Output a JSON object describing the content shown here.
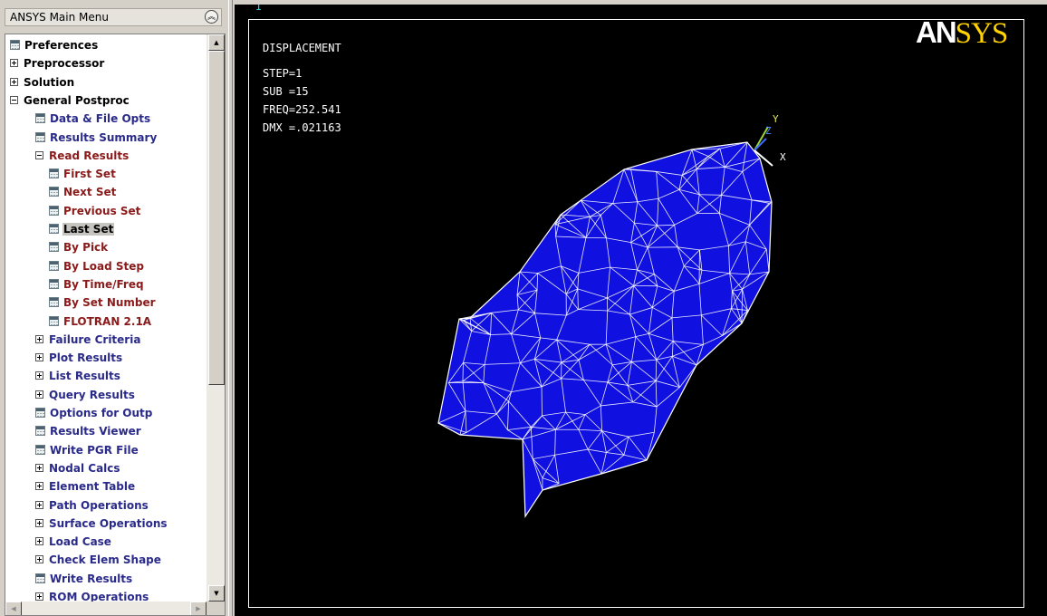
{
  "menu": {
    "title": "ANSYS Main Menu",
    "collapse_icon": "double-chevron-up-icon",
    "items": [
      {
        "label": "Preferences",
        "icon": "calc",
        "level": 0,
        "color": "#000000",
        "selected": false
      },
      {
        "label": "Preprocessor",
        "icon": "plus",
        "level": 0,
        "color": "#000000",
        "selected": false
      },
      {
        "label": "Solution",
        "icon": "plus",
        "level": 0,
        "color": "#000000",
        "selected": false
      },
      {
        "label": "General Postproc",
        "icon": "minus",
        "level": 0,
        "color": "#000000",
        "selected": false
      },
      {
        "label": "Data & File Opts",
        "icon": "calc",
        "level": 1,
        "color": "#2a2a8a",
        "selected": false
      },
      {
        "label": "Results Summary",
        "icon": "calc",
        "level": 1,
        "color": "#2a2a8a",
        "selected": false
      },
      {
        "label": "Read Results",
        "icon": "minus",
        "level": 1,
        "color": "#8b1a1a",
        "selected": false
      },
      {
        "label": "First Set",
        "icon": "calc",
        "level": 2,
        "color": "#8b1a1a",
        "selected": false
      },
      {
        "label": "Next Set",
        "icon": "calc",
        "level": 2,
        "color": "#8b1a1a",
        "selected": false
      },
      {
        "label": "Previous Set",
        "icon": "calc",
        "level": 2,
        "color": "#8b1a1a",
        "selected": false
      },
      {
        "label": "Last Set",
        "icon": "calc",
        "level": 2,
        "color": "#000000",
        "selected": true
      },
      {
        "label": "By Pick",
        "icon": "calc",
        "level": 2,
        "color": "#8b1a1a",
        "selected": false
      },
      {
        "label": "By Load Step",
        "icon": "calc",
        "level": 2,
        "color": "#8b1a1a",
        "selected": false
      },
      {
        "label": "By Time/Freq",
        "icon": "calc",
        "level": 2,
        "color": "#8b1a1a",
        "selected": false
      },
      {
        "label": "By Set Number",
        "icon": "calc",
        "level": 2,
        "color": "#8b1a1a",
        "selected": false
      },
      {
        "label": "FLOTRAN 2.1A",
        "icon": "calc",
        "level": 2,
        "color": "#8b1a1a",
        "selected": false
      },
      {
        "label": "Failure Criteria",
        "icon": "plus",
        "level": 1,
        "color": "#2a2a8a",
        "selected": false
      },
      {
        "label": "Plot Results",
        "icon": "plus",
        "level": 1,
        "color": "#2a2a8a",
        "selected": false
      },
      {
        "label": "List Results",
        "icon": "plus",
        "level": 1,
        "color": "#2a2a8a",
        "selected": false
      },
      {
        "label": "Query Results",
        "icon": "plus",
        "level": 1,
        "color": "#2a2a8a",
        "selected": false
      },
      {
        "label": "Options for Outp",
        "icon": "calc",
        "level": 1,
        "color": "#2a2a8a",
        "selected": false
      },
      {
        "label": "Results Viewer",
        "icon": "calc",
        "level": 1,
        "color": "#2a2a8a",
        "selected": false
      },
      {
        "label": "Write PGR File",
        "icon": "calc",
        "level": 1,
        "color": "#2a2a8a",
        "selected": false
      },
      {
        "label": "Nodal Calcs",
        "icon": "plus",
        "level": 1,
        "color": "#2a2a8a",
        "selected": false
      },
      {
        "label": "Element Table",
        "icon": "plus",
        "level": 1,
        "color": "#2a2a8a",
        "selected": false
      },
      {
        "label": "Path Operations",
        "icon": "plus",
        "level": 1,
        "color": "#2a2a8a",
        "selected": false
      },
      {
        "label": "Surface Operations",
        "icon": "plus",
        "level": 1,
        "color": "#2a2a8a",
        "selected": false
      },
      {
        "label": "Load Case",
        "icon": "plus",
        "level": 1,
        "color": "#2a2a8a",
        "selected": false
      },
      {
        "label": "Check Elem Shape",
        "icon": "plus",
        "level": 1,
        "color": "#2a2a8a",
        "selected": false
      },
      {
        "label": "Write Results",
        "icon": "calc",
        "level": 1,
        "color": "#2a2a8a",
        "selected": false
      },
      {
        "label": "ROM Operations",
        "icon": "plus",
        "level": 1,
        "color": "#2a2a8a",
        "selected": false
      }
    ]
  },
  "graphics": {
    "window_number": "1",
    "result_type": "DISPLACEMENT",
    "step": "STEP=1",
    "sub": "SUB =15",
    "freq": "FREQ=252.541",
    "dmx": "DMX =.021163",
    "logo_an": "AN",
    "logo_sys": "SYS",
    "triad": {
      "x": "X",
      "y": "Y",
      "z": "Z"
    },
    "mesh_color": "#1010e0",
    "edge_color": "#ffffff"
  }
}
